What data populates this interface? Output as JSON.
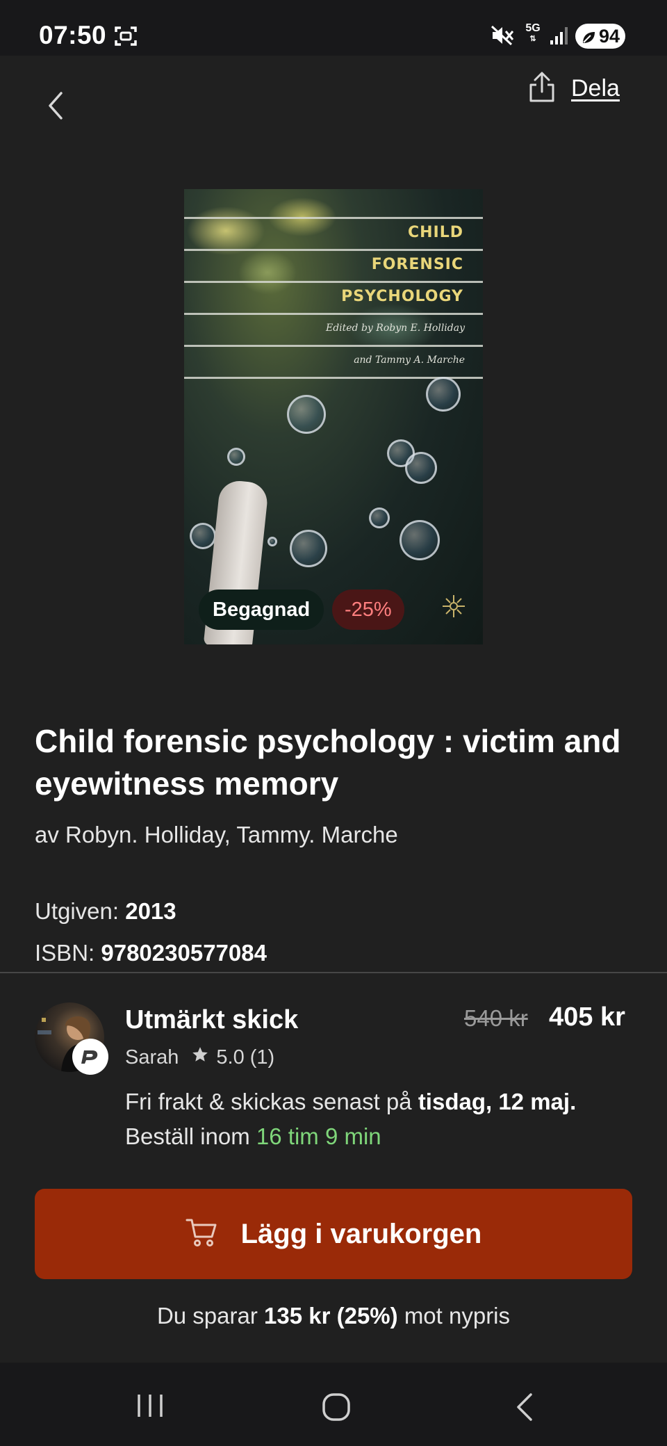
{
  "status_bar": {
    "time": "07:50",
    "network": "5G",
    "battery": "94"
  },
  "header": {
    "share_label": "Dela"
  },
  "cover": {
    "title_line1": "CHILD",
    "title_line2": "FORENSIC",
    "title_line3": "PSYCHOLOGY",
    "editor_line1": "Edited by Robyn E. Holliday",
    "editor_line2": "and Tammy A. Marche"
  },
  "badges": {
    "condition": "Begagnad",
    "discount": "-25%"
  },
  "book": {
    "title": "Child forensic psychology : victim and eyewitness memory",
    "authors": "av Robyn. Holliday, Tammy. Marche",
    "published_label": "Utgiven:",
    "published_value": "2013",
    "isbn_label": "ISBN:",
    "isbn_value": "9780230577084"
  },
  "offer": {
    "condition": "Utmärkt skick",
    "seller_name": "Sarah",
    "rating": "5.0",
    "rating_count": "(1)",
    "old_price": "540 kr",
    "price": "405 kr",
    "shipping_text": "Fri frakt & skickas senast på",
    "shipping_date": "tisdag, 12 maj.",
    "order_within_label": "Beställ inom",
    "order_within_time": "16 tim 9 min"
  },
  "cart": {
    "button_label": "Lägg i varukorgen"
  },
  "savings": {
    "prefix": "Du sparar",
    "amount": "135 kr (25%)",
    "suffix": "mot nypris"
  },
  "colors": {
    "background": "#202020",
    "cart_button": "#9a2a08",
    "countdown_green": "#7fd67a",
    "discount_text": "#ff7f7f"
  }
}
